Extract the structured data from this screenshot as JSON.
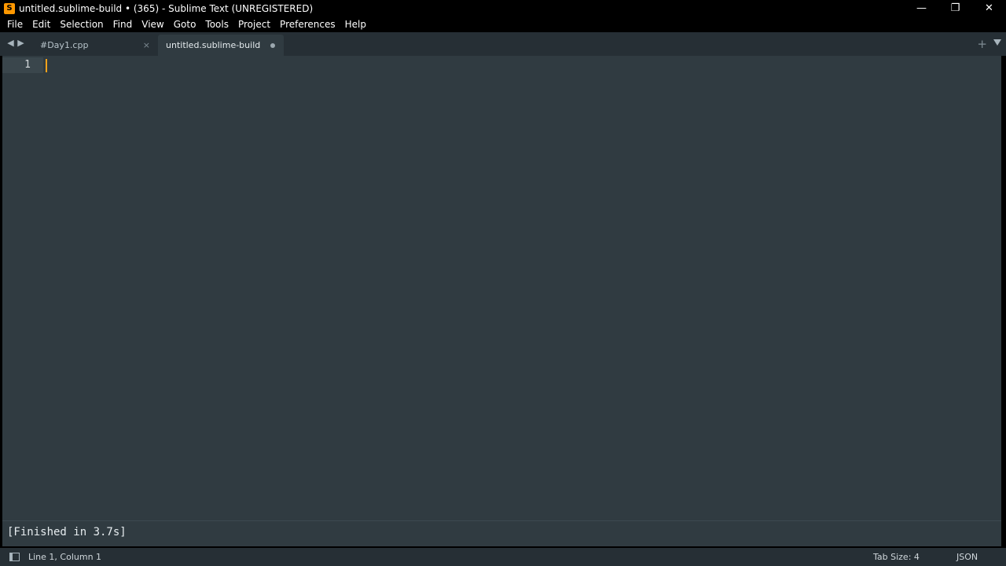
{
  "window": {
    "title": "untitled.sublime-build • (365) - Sublime Text (UNREGISTERED)",
    "app_icon": "S",
    "controls": {
      "minimize": "—",
      "restore": "❐",
      "close": "✕"
    }
  },
  "menu": [
    "File",
    "Edit",
    "Selection",
    "Find",
    "View",
    "Goto",
    "Tools",
    "Project",
    "Preferences",
    "Help"
  ],
  "tabs": [
    {
      "label": "#Day1.cpp",
      "close": "×",
      "active": false
    },
    {
      "label": "untitled.sublime-build",
      "active": true,
      "dirty": true
    }
  ],
  "tabbar": {
    "prev": "◀",
    "next": "▶",
    "new_tab": "+"
  },
  "editor": {
    "line_numbers": [
      "1"
    ],
    "cursor_color": "#f7a21b"
  },
  "output": {
    "text": "[Finished in 3.7s]"
  },
  "status": {
    "position": "Line 1, Column 1",
    "tab_size": "Tab Size: 4",
    "syntax": "JSON"
  },
  "colors": {
    "editor_bg": "#303b41",
    "tabbar_bg": "#262f35",
    "accent": "#ff9800"
  }
}
